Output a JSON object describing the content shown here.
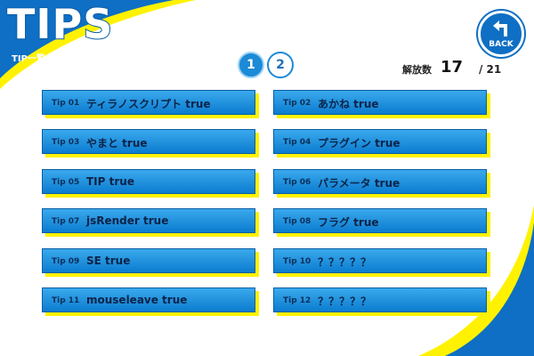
{
  "header": {
    "title": "TIPS",
    "subtitle": "TIP一覧",
    "back_label": "BACK"
  },
  "pagination": {
    "pages": [
      "1",
      "2"
    ],
    "current": "1"
  },
  "counter": {
    "label": "解放数",
    "value": "17",
    "total": "/ 21"
  },
  "tips": [
    {
      "num": "Tip 01",
      "name": "ティラノスクリプト true"
    },
    {
      "num": "Tip 02",
      "name": "あかね true"
    },
    {
      "num": "Tip 03",
      "name": "やまと true"
    },
    {
      "num": "Tip 04",
      "name": "プラグイン true"
    },
    {
      "num": "Tip 05",
      "name": "TIP true"
    },
    {
      "num": "Tip 06",
      "name": "パラメータ true"
    },
    {
      "num": "Tip 07",
      "name": "jsRender true"
    },
    {
      "num": "Tip 08",
      "name": "フラグ true"
    },
    {
      "num": "Tip 09",
      "name": "SE true"
    },
    {
      "num": "Tip 10",
      "name": "？？？？？"
    },
    {
      "num": "Tip 11",
      "name": "mouseleave true"
    },
    {
      "num": "Tip 12",
      "name": "？？？？？"
    }
  ],
  "colors": {
    "accent": "#0e6fc4",
    "highlight": "#fff200"
  }
}
